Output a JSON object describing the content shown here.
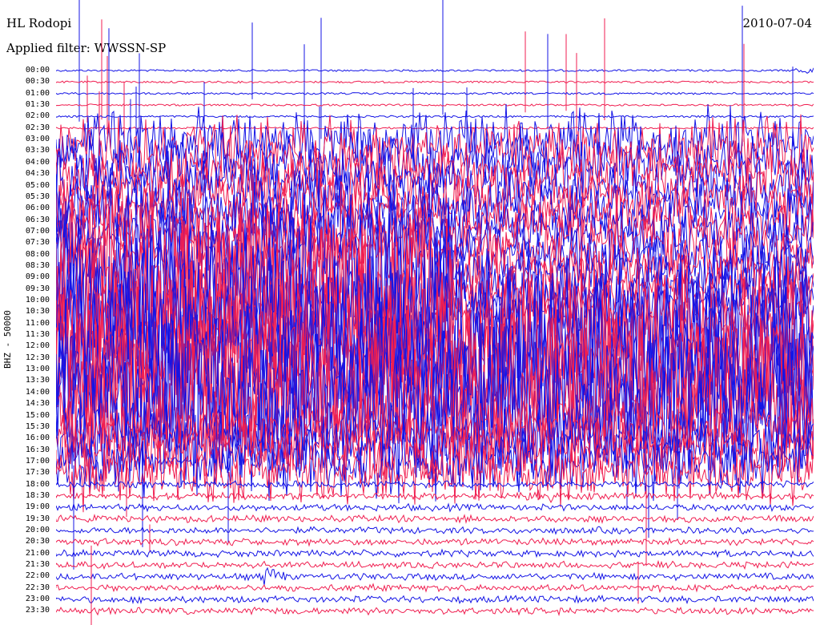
{
  "header": {
    "station": "HL Rodopi",
    "filter": "Applied filter: WWSSN-SP",
    "date": "2010-07-04"
  },
  "axis": {
    "channel_label": "BHZ - 50000"
  },
  "trace_labels": [
    "00:00",
    "00:30",
    "01:00",
    "01:30",
    "02:00",
    "02:30",
    "03:00",
    "03:30",
    "04:00",
    "04:30",
    "05:00",
    "05:30",
    "06:00",
    "06:30",
    "07:00",
    "07:30",
    "08:00",
    "08:30",
    "09:00",
    "09:30",
    "10:00",
    "10:30",
    "11:00",
    "11:30",
    "12:00",
    "12:30",
    "13:00",
    "13:30",
    "14:00",
    "14:30",
    "15:00",
    "15:30",
    "16:00",
    "16:30",
    "17:00",
    "17:30",
    "18:00",
    "18:30",
    "19:00",
    "19:30",
    "20:00",
    "20:30",
    "21:00",
    "21:30",
    "22:00",
    "22:30",
    "23:00",
    "23:30"
  ],
  "colors": {
    "even_trace": "#1414e6",
    "odd_trace": "#f01e50",
    "background": "#ffffff"
  }
}
